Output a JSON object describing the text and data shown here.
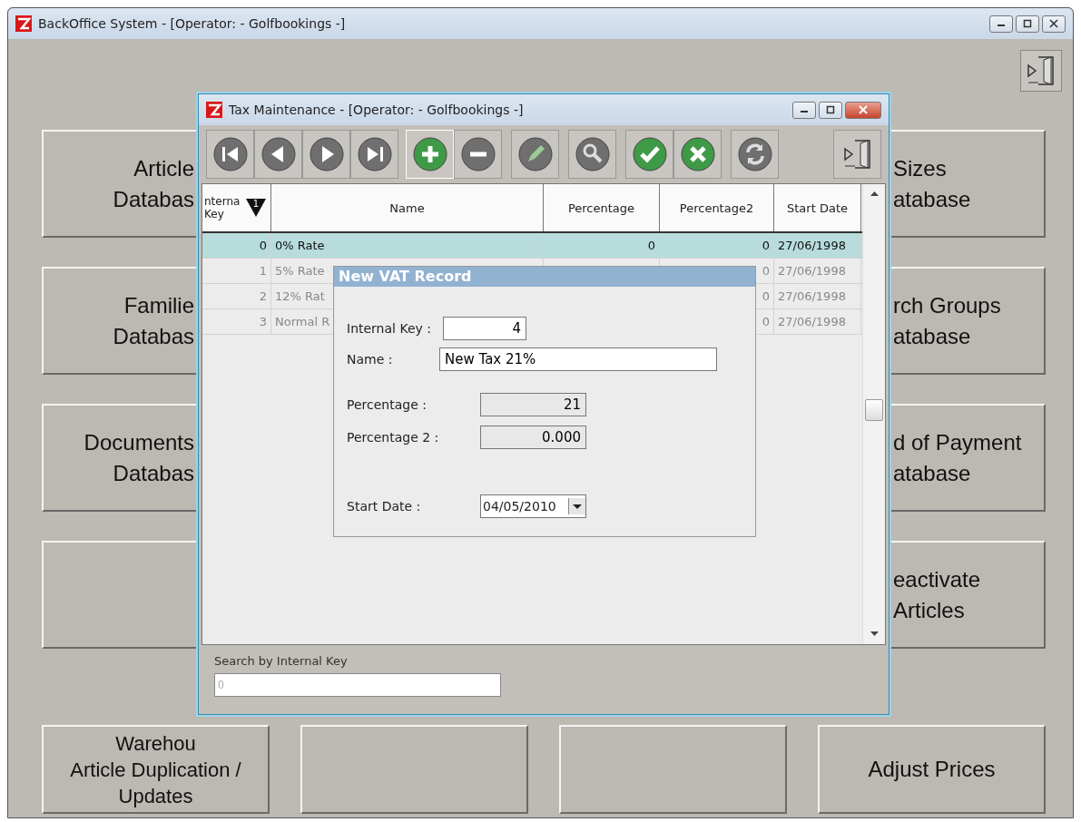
{
  "main_window": {
    "title": "BackOffice System  - [Operator: - Golfbookings -]"
  },
  "left_buttons": [
    {
      "kind": "text",
      "lines": [
        "Article",
        "Databas"
      ]
    },
    {
      "kind": "text",
      "lines": [
        "Familie",
        "Databas"
      ]
    },
    {
      "kind": "text",
      "lines": [
        "Documents",
        "Databas"
      ]
    },
    {
      "kind": "blank"
    },
    {
      "kind": "text",
      "lines": [
        "Warehou",
        "Article Duplication /",
        "Updates"
      ]
    }
  ],
  "middle_buttons": [
    {
      "kind": "blank"
    },
    {
      "kind": "blank"
    }
  ],
  "right_buttons": [
    {
      "kind": "text",
      "lines": [
        "Sizes",
        "atabase"
      ]
    },
    {
      "kind": "text",
      "lines": [
        "rch Groups",
        "atabase"
      ]
    },
    {
      "kind": "text",
      "lines": [
        "d of Payment",
        "atabase"
      ]
    },
    {
      "kind": "text",
      "lines": [
        "eactivate",
        "Articles"
      ]
    },
    {
      "kind": "text",
      "lines": [
        "Adjust Prices"
      ]
    }
  ],
  "tax_window": {
    "title": "Tax Maintenance - [Operator: - Golfbookings -]",
    "toolbar": [
      {
        "kind": "first",
        "enabled": false
      },
      {
        "kind": "previous",
        "enabled": false
      },
      {
        "kind": "next",
        "enabled": false
      },
      {
        "kind": "last",
        "enabled": false
      },
      {
        "kind": "add",
        "enabled": true
      },
      {
        "kind": "remove",
        "enabled": false
      },
      {
        "kind": "edit",
        "enabled": false
      },
      {
        "kind": "search",
        "enabled": false
      },
      {
        "kind": "confirm",
        "enabled": true
      },
      {
        "kind": "cancel",
        "enabled": true
      },
      {
        "kind": "refresh",
        "enabled": false
      },
      {
        "kind": "exit",
        "enabled": true
      }
    ],
    "table": {
      "columns": [
        {
          "label": "nterna Key",
          "sort_order": "1"
        },
        {
          "label": "Name"
        },
        {
          "label": "Percentage"
        },
        {
          "label": "Percentage2"
        },
        {
          "label": "Start Date"
        }
      ],
      "rows": [
        {
          "selected": true,
          "key": "0",
          "name": "0% Rate",
          "percentage": "0",
          "percentage2": "0",
          "start_date": "27/06/1998"
        },
        {
          "selected": false,
          "key": "1",
          "name": "5% Rate",
          "percentage2": "0",
          "start_date": "27/06/1998"
        },
        {
          "selected": false,
          "key": "2",
          "name": "12% Rat",
          "percentage2": "0",
          "start_date": "27/06/1998"
        },
        {
          "selected": false,
          "key": "3",
          "name": "Normal R",
          "percentage2": "0",
          "start_date": "27/06/1998"
        }
      ]
    },
    "search": {
      "label": "Search by Internal Key",
      "placeholder": "0"
    }
  },
  "dialog": {
    "title": "New VAT Record",
    "fields": [
      {
        "kind": "key",
        "label": "Internal Key :",
        "value": "4"
      },
      {
        "kind": "text",
        "label": "Name :",
        "value": "New Tax 21%"
      },
      {
        "kind": "number",
        "label": "Percentage :",
        "value": "21"
      },
      {
        "kind": "number",
        "label": "Percentage 2 :",
        "value": "0.000"
      },
      {
        "kind": "date",
        "label": "Start Date :",
        "value": "04/05/2010"
      }
    ]
  }
}
